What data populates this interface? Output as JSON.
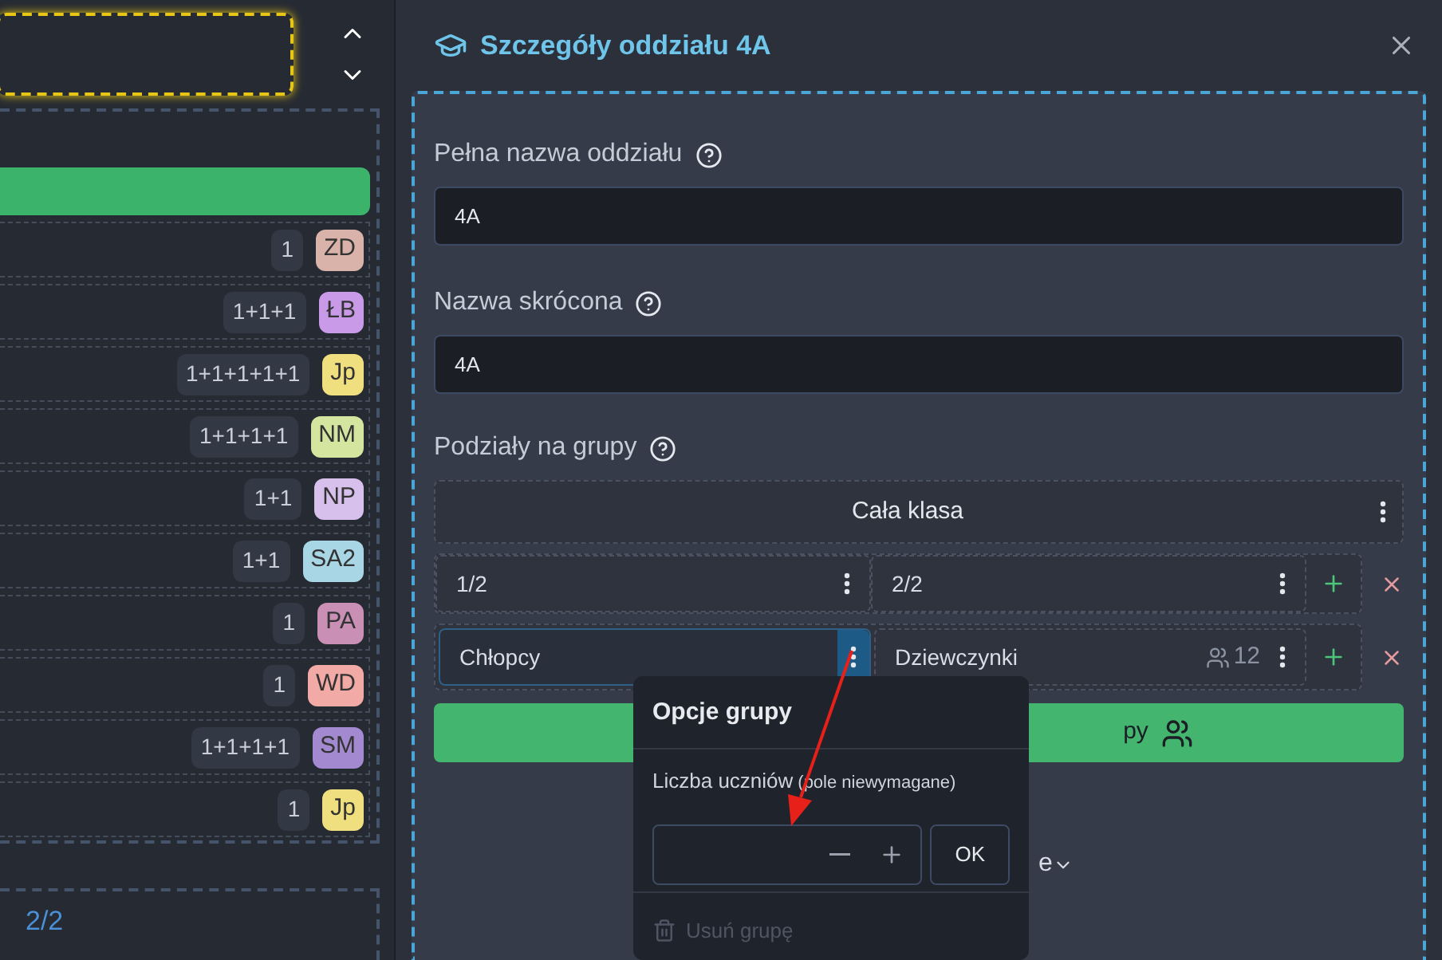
{
  "left_panel": {
    "rows": [
      {
        "count": "1",
        "badge": "ZD",
        "color": "#d9b2a9"
      },
      {
        "count": "1+1+1",
        "badge": "ŁB",
        "color": "#c89ae8"
      },
      {
        "count": "1+1+1+1+1",
        "badge": "Jp",
        "color": "#f0df7e"
      },
      {
        "count": "1+1+1+1",
        "badge": "NM",
        "color": "#d4e5a0"
      },
      {
        "count": "1+1",
        "badge": "NP",
        "color": "#d7c0ec"
      },
      {
        "count": "1+1",
        "badge": "SA2",
        "color": "#a9d6e5"
      },
      {
        "count": "1",
        "badge": "PA",
        "color": "#c98fb5"
      },
      {
        "count": "1",
        "badge": "WD",
        "color": "#f2aaa6"
      },
      {
        "count": "1+1+1+1",
        "badge": "SM",
        "color": "#a389cf"
      },
      {
        "count": "1",
        "badge": "Jp",
        "color": "#f0df7e"
      }
    ],
    "pager": "2/2"
  },
  "dialog": {
    "title": "Szczegóły oddziału 4A",
    "fields": [
      {
        "label": "Pełna nazwa oddziału",
        "value": "4A"
      },
      {
        "label": "Nazwa skrócona",
        "value": "4A"
      }
    ],
    "divisions": {
      "label": "Podziały na grupy",
      "whole_class": "Cała klasa",
      "rows": [
        {
          "groups": [
            {
              "name": "1/2",
              "selected": false
            },
            {
              "name": "2/2",
              "selected": false
            }
          ]
        },
        {
          "groups": [
            {
              "name": "Chłopcy",
              "selected": true
            },
            {
              "name": "Dziewczynki",
              "selected": false,
              "count": "12"
            }
          ]
        }
      ]
    },
    "add_button": "py",
    "collapsed_text": "e"
  },
  "popover": {
    "title": "Opcje grupy",
    "label": "Liczba uczniów",
    "hint": "(pole niewymagane)",
    "ok": "OK",
    "delete": "Usuń grupę"
  }
}
